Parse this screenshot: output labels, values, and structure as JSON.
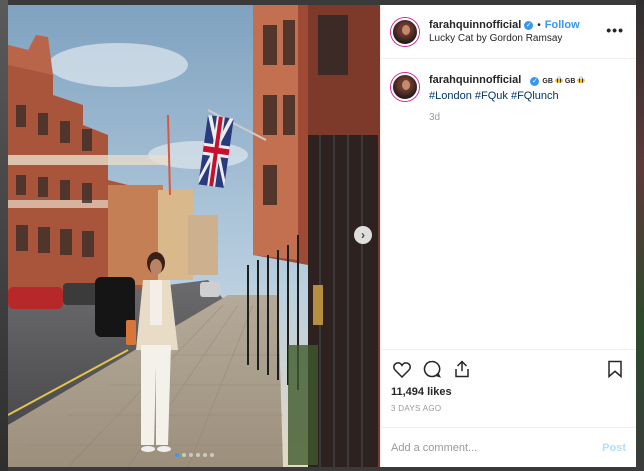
{
  "post": {
    "username": "farahquinnofficial",
    "follow_label": "Follow",
    "separator": "•",
    "location": "Lucky Cat by Gordon Ramsay",
    "more_label": "•••",
    "verified_mark": "✓"
  },
  "caption": {
    "username": "farahquinnofficial",
    "flag_1": "GB",
    "flag_2": "GB",
    "hashtags": [
      "#London",
      "#FQuk",
      "#FQlunch"
    ],
    "time_ago": "3d"
  },
  "actions": {
    "icons": [
      "heart-icon",
      "comment-icon",
      "share-icon",
      "bookmark-icon"
    ],
    "likes": "11,494 likes",
    "date": "3 DAYS AGO"
  },
  "comment": {
    "placeholder": "Add a comment...",
    "post_label": "Post"
  },
  "photo": {
    "next_label": "›",
    "carousel_dots": 6,
    "active_dot": 0
  },
  "colors": {
    "accent": "#3897f0",
    "hashtag": "#003569",
    "muted": "#999999",
    "post_disabled": "#b2dffc"
  }
}
